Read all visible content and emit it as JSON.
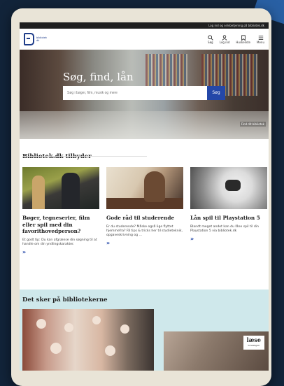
{
  "topbar": {
    "text": "Log ind og selvbetjening på bibliotek.dk"
  },
  "header": {
    "logo_line1": "bibliotek",
    "logo_line2": "dk",
    "nav": [
      {
        "label": "Søg",
        "icon": "search-icon"
      },
      {
        "label": "Log ind",
        "icon": "user-icon"
      },
      {
        "label": "Huskeliste",
        "icon": "bookmark-icon"
      },
      {
        "label": "Menu",
        "icon": "menu-icon"
      }
    ]
  },
  "hero": {
    "title": "Søg, find, lån",
    "search_placeholder": "Søg i bøger, film, musik og mere",
    "search_button": "Søg",
    "link": "Find dit bibliotek"
  },
  "offers": {
    "title": "Bibliotek.dk tilbyder",
    "cards": [
      {
        "title": "Bøger, tegneserier, film eller spil med din favorithovedperson?",
        "text": "Et godt tip: Du kan afgrænse din søgning til at handle om din yndlingskarakter.",
        "arrow": "»"
      },
      {
        "title": "Gode råd til studerende",
        "text": "Er du studerende? Måske også lige flyttet hjemmefra? Få tips & tricks her til studieteknik, opgaveskrivning og ...",
        "arrow": "»"
      },
      {
        "title": "Lån spil til Playstation 5",
        "text": "Blandt meget andet kan du låne spil til din Playstation 5 via bibliotek.dk",
        "arrow": "»"
      }
    ]
  },
  "events": {
    "title": "Det sker på bibliotekerne",
    "tag_main": "læse",
    "tag_sub": "foreningen"
  }
}
